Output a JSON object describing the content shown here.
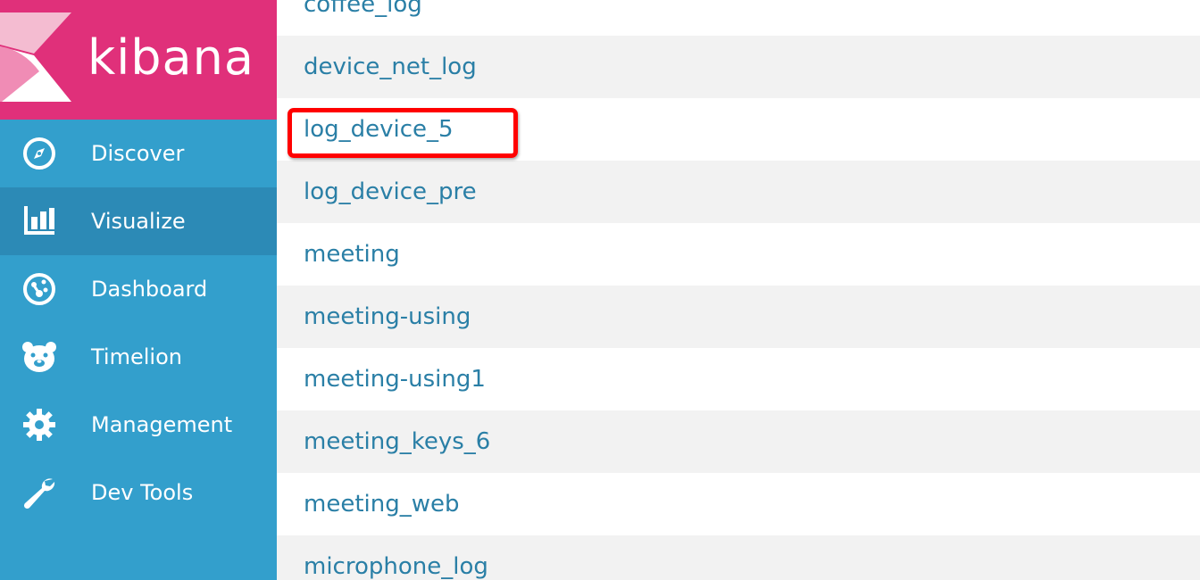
{
  "brand": {
    "name": "kibana",
    "color": "#e0307a"
  },
  "sidebar": {
    "background": "#339fcc",
    "active_background": "#2c8ab6",
    "items": [
      {
        "label": "Discover",
        "icon": "compass-icon",
        "active": false
      },
      {
        "label": "Visualize",
        "icon": "bar-chart-icon",
        "active": true
      },
      {
        "label": "Dashboard",
        "icon": "dashboard-gauge-icon",
        "active": false
      },
      {
        "label": "Timelion",
        "icon": "bear-icon",
        "active": false
      },
      {
        "label": "Management",
        "icon": "gear-icon",
        "active": false
      },
      {
        "label": "Dev Tools",
        "icon": "wrench-icon",
        "active": false
      }
    ]
  },
  "list": {
    "link_color": "#2a7fa6",
    "rows": [
      {
        "label": "coffee_log"
      },
      {
        "label": "device_net_log"
      },
      {
        "label": "log_device_5",
        "highlighted": true
      },
      {
        "label": "log_device_pre"
      },
      {
        "label": "meeting"
      },
      {
        "label": "meeting-using"
      },
      {
        "label": "meeting-using1"
      },
      {
        "label": "meeting_keys_6"
      },
      {
        "label": "meeting_web"
      },
      {
        "label": "microphone_log"
      }
    ]
  },
  "annotation": {
    "color": "#ff0000"
  }
}
